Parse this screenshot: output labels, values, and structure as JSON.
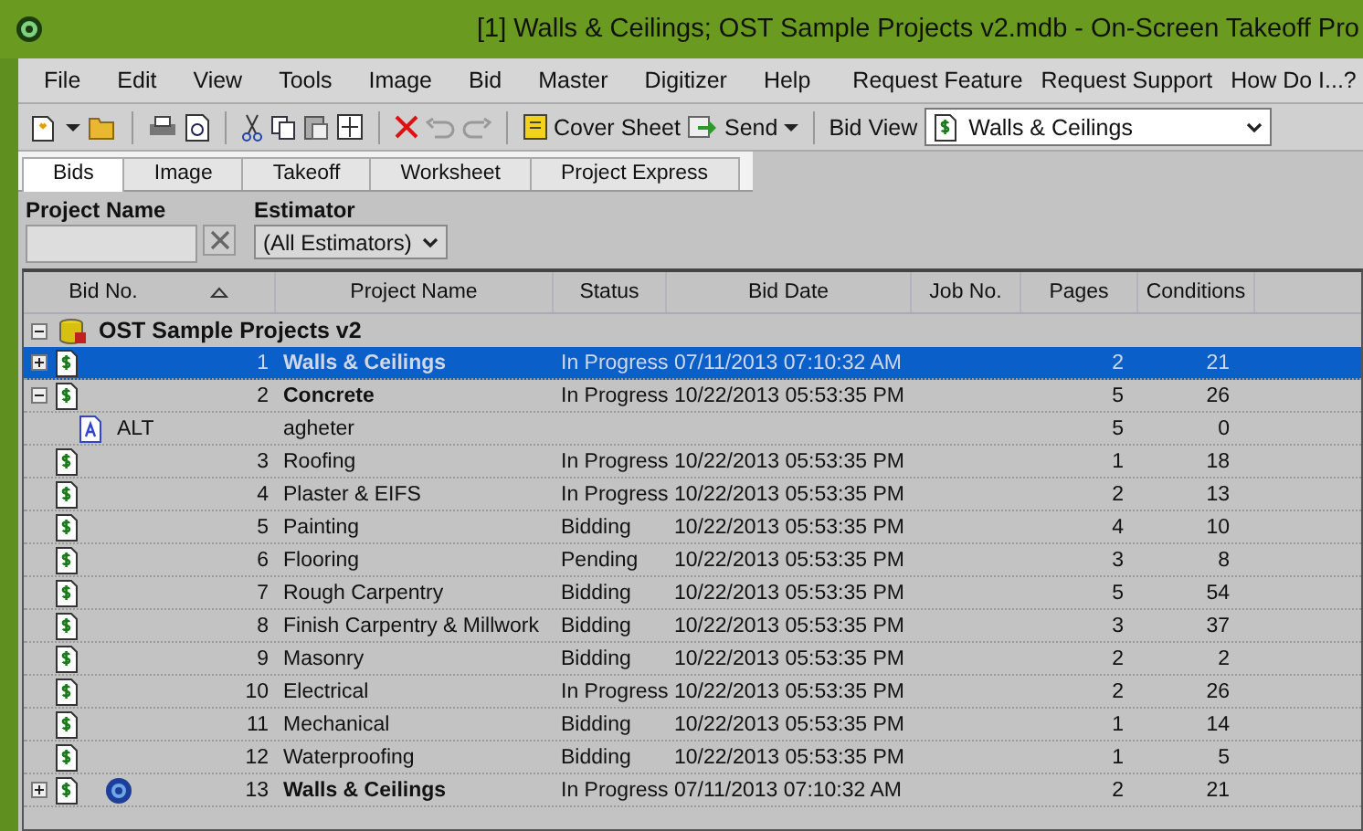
{
  "window": {
    "title": "[1] Walls & Ceilings; OST Sample Projects v2.mdb - On-Screen Takeoff Pro"
  },
  "menu": [
    "File",
    "Edit",
    "View",
    "Tools",
    "Image",
    "Bid",
    "Master",
    "Digitizer",
    "Help"
  ],
  "menu_links": [
    "Request Feature",
    "Request Support",
    "How Do I...?"
  ],
  "toolbar": {
    "cover_sheet": "Cover Sheet",
    "send": "Send",
    "bid_view_label": "Bid View",
    "bid_view": "Walls & Ceilings"
  },
  "tabs": [
    {
      "label": "Bids",
      "selected": true
    },
    {
      "label": "Image",
      "selected": false
    },
    {
      "label": "Takeoff",
      "selected": false
    },
    {
      "label": "Worksheet",
      "selected": false
    },
    {
      "label": "Project Express",
      "selected": false
    }
  ],
  "filter": {
    "project_name_label": "Project Name",
    "estimator_label": "Estimator",
    "estimator": "(All Estimators)"
  },
  "table": {
    "columns": [
      "Bid No.",
      "Project Name",
      "Status",
      "Bid Date",
      "Job No.",
      "Pages",
      "Conditions"
    ],
    "group": {
      "name": "OST Sample Projects v2",
      "expanded": true
    },
    "rows": [
      {
        "kind": "bid",
        "bid_no": "1",
        "name": "Walls & Ceilings",
        "status": "In Progress",
        "bid_date": "07/11/2013 07:10:32 AM",
        "pages": "2",
        "conditions": "21",
        "bold": true,
        "expanded": false,
        "selected": true
      },
      {
        "kind": "bid",
        "bid_no": "2",
        "name": "Concrete",
        "status": "In Progress",
        "bid_date": "10/22/2013 05:53:35 PM",
        "pages": "5",
        "conditions": "26",
        "bold": true,
        "expanded": true,
        "selected": false
      },
      {
        "kind": "alternate",
        "bid_no": "ALT",
        "name": "agheter",
        "pages": "5",
        "conditions": "0",
        "bold": false,
        "selected": false
      },
      {
        "kind": "bid",
        "bid_no": "3",
        "name": "Roofing",
        "status": "In Progress",
        "bid_date": "10/22/2013 05:53:35 PM",
        "pages": "1",
        "conditions": "18",
        "bold": false,
        "selected": false
      },
      {
        "kind": "bid",
        "bid_no": "4",
        "name": "Plaster & EIFS",
        "status": "In Progress",
        "bid_date": "10/22/2013 05:53:35 PM",
        "pages": "2",
        "conditions": "13",
        "bold": false,
        "selected": false
      },
      {
        "kind": "bid",
        "bid_no": "5",
        "name": "Painting",
        "status": "Bidding",
        "bid_date": "10/22/2013 05:53:35 PM",
        "pages": "4",
        "conditions": "10",
        "bold": false,
        "selected": false
      },
      {
        "kind": "bid",
        "bid_no": "6",
        "name": "Flooring",
        "status": "Pending",
        "bid_date": "10/22/2013 05:53:35 PM",
        "pages": "3",
        "conditions": "8",
        "bold": false,
        "selected": false
      },
      {
        "kind": "bid",
        "bid_no": "7",
        "name": "Rough Carpentry",
        "status": "Bidding",
        "bid_date": "10/22/2013 05:53:35 PM",
        "pages": "5",
        "conditions": "54",
        "bold": false,
        "selected": false
      },
      {
        "kind": "bid",
        "bid_no": "8",
        "name": "Finish Carpentry & Millwork",
        "status": "Bidding",
        "bid_date": "10/22/2013 05:53:35 PM",
        "pages": "3",
        "conditions": "37",
        "bold": false,
        "selected": false
      },
      {
        "kind": "bid",
        "bid_no": "9",
        "name": "Masonry",
        "status": "Bidding",
        "bid_date": "10/22/2013 05:53:35 PM",
        "pages": "2",
        "conditions": "2",
        "bold": false,
        "selected": false
      },
      {
        "kind": "bid",
        "bid_no": "10",
        "name": "Electrical",
        "status": "In Progress",
        "bid_date": "10/22/2013 05:53:35 PM",
        "pages": "2",
        "conditions": "26",
        "bold": false,
        "selected": false
      },
      {
        "kind": "bid",
        "bid_no": "11",
        "name": "Mechanical",
        "status": "Bidding",
        "bid_date": "10/22/2013 05:53:35 PM",
        "pages": "1",
        "conditions": "14",
        "bold": false,
        "selected": false
      },
      {
        "kind": "bid",
        "bid_no": "12",
        "name": "Waterproofing",
        "status": "Bidding",
        "bid_date": "10/22/2013 05:53:35 PM",
        "pages": "1",
        "conditions": "5",
        "bold": false,
        "selected": false
      },
      {
        "kind": "linked-bid",
        "bid_no": "13",
        "name": "Walls & Ceilings",
        "status": "In Progress",
        "bid_date": "07/11/2013 07:10:32 AM",
        "pages": "2",
        "conditions": "21",
        "bold": true,
        "expanded": false,
        "selected": false
      }
    ]
  }
}
